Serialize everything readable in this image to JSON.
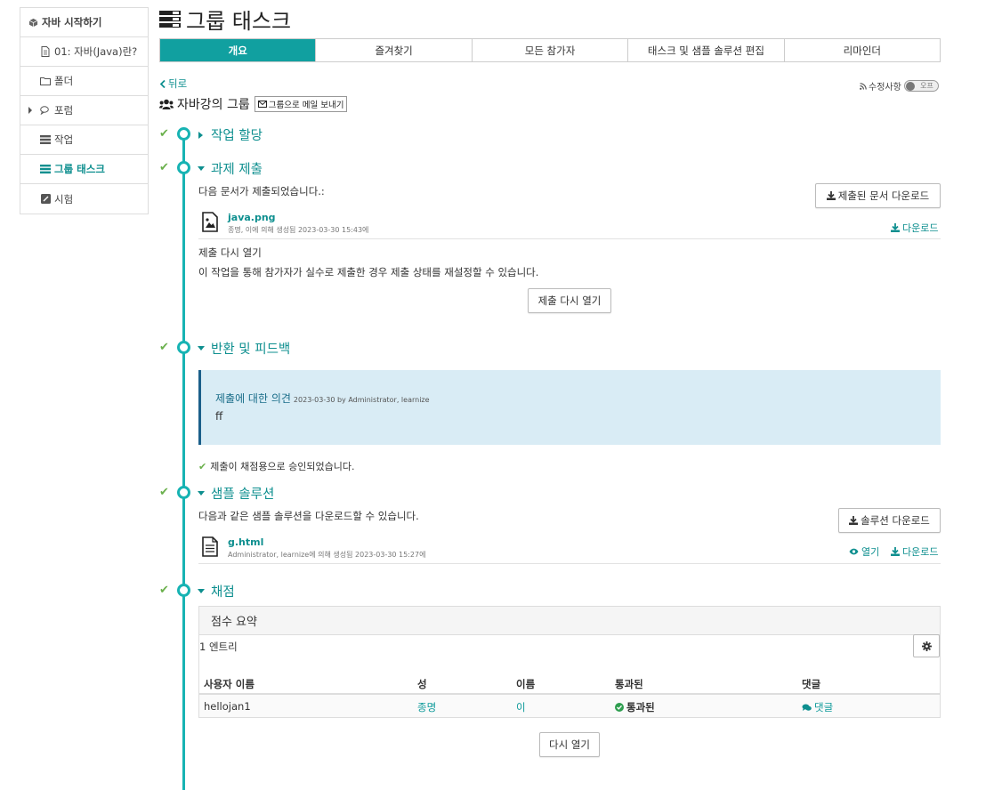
{
  "sidebar": {
    "items": [
      {
        "label": "자바 시작하기",
        "icon": "cube-icon"
      },
      {
        "label": "01: 자바(Java)란?",
        "icon": "document-icon"
      },
      {
        "label": "폴더",
        "icon": "folder-icon"
      },
      {
        "label": "포럼",
        "icon": "chat-icon"
      },
      {
        "label": "작업",
        "icon": "task-icon"
      },
      {
        "label": "그룹 태스크",
        "icon": "group-task-icon"
      },
      {
        "label": "시험",
        "icon": "test-icon"
      }
    ]
  },
  "header": {
    "title": "그룹 태스크"
  },
  "tabs": [
    "개요",
    "즐겨찾기",
    "모든 참가자",
    "태스크 및 샘플 솔루션 편집",
    "리마인더"
  ],
  "nav": {
    "back": "뒤로",
    "changes_label": "수정사항",
    "toggle_label": "오프"
  },
  "group": {
    "name": "자바강의 그룹",
    "mail_button": "그룹으로 메일 보내기"
  },
  "sections": {
    "assignment": {
      "title": "작업 할당"
    },
    "submission": {
      "title": "과제 제출",
      "intro": "다음 문서가 제출되었습니다.:",
      "download_all": "제출된 문서 다운로드",
      "file_name": "java.png",
      "file_meta": "종명, 이에 의해 생성됨 2023-03-30 15:43에",
      "file_download": "다운로드",
      "reopen_heading": "제출 다시 열기",
      "reopen_desc": "이 작업을 통해 참가자가 실수로 제출한 경우 제출 상태를 재설정할 수 있습니다.",
      "reopen_button": "제출 다시 열기"
    },
    "feedback": {
      "title": "반환 및 피드백",
      "comment_title": "제출에 대한 의견",
      "comment_meta": "2023-03-30 by Administrator, learnize",
      "comment_body": "ff",
      "approved": "제출이 채점용으로 승인되었습니다."
    },
    "solution": {
      "title": "샘플 솔루션",
      "intro": "다음과 같은 샘플 솔루션을 다운로드할 수 있습니다.",
      "download_button": "솔루션 다운로드",
      "file_name": "g.html",
      "file_meta": "Administrator, learnize에 의해 생성됨 2023-03-30 15:27에",
      "open_link": "열기",
      "file_download": "다운로드"
    },
    "grading": {
      "title": "채점",
      "panel_title": "점수 요약",
      "entries": "1 엔트리",
      "columns": [
        "사용자 이름",
        "성",
        "이름",
        "통과된",
        "댓글"
      ],
      "rows": [
        {
          "username": "hellojan1",
          "last": "종명",
          "first": "이",
          "passed": "통과된",
          "comment": "댓글"
        }
      ],
      "reopen_button": "다시 열기"
    }
  },
  "colors": {
    "accent": "#11a0a0",
    "check": "#6ab04c",
    "feedback_bg": "#d9ecf5"
  }
}
